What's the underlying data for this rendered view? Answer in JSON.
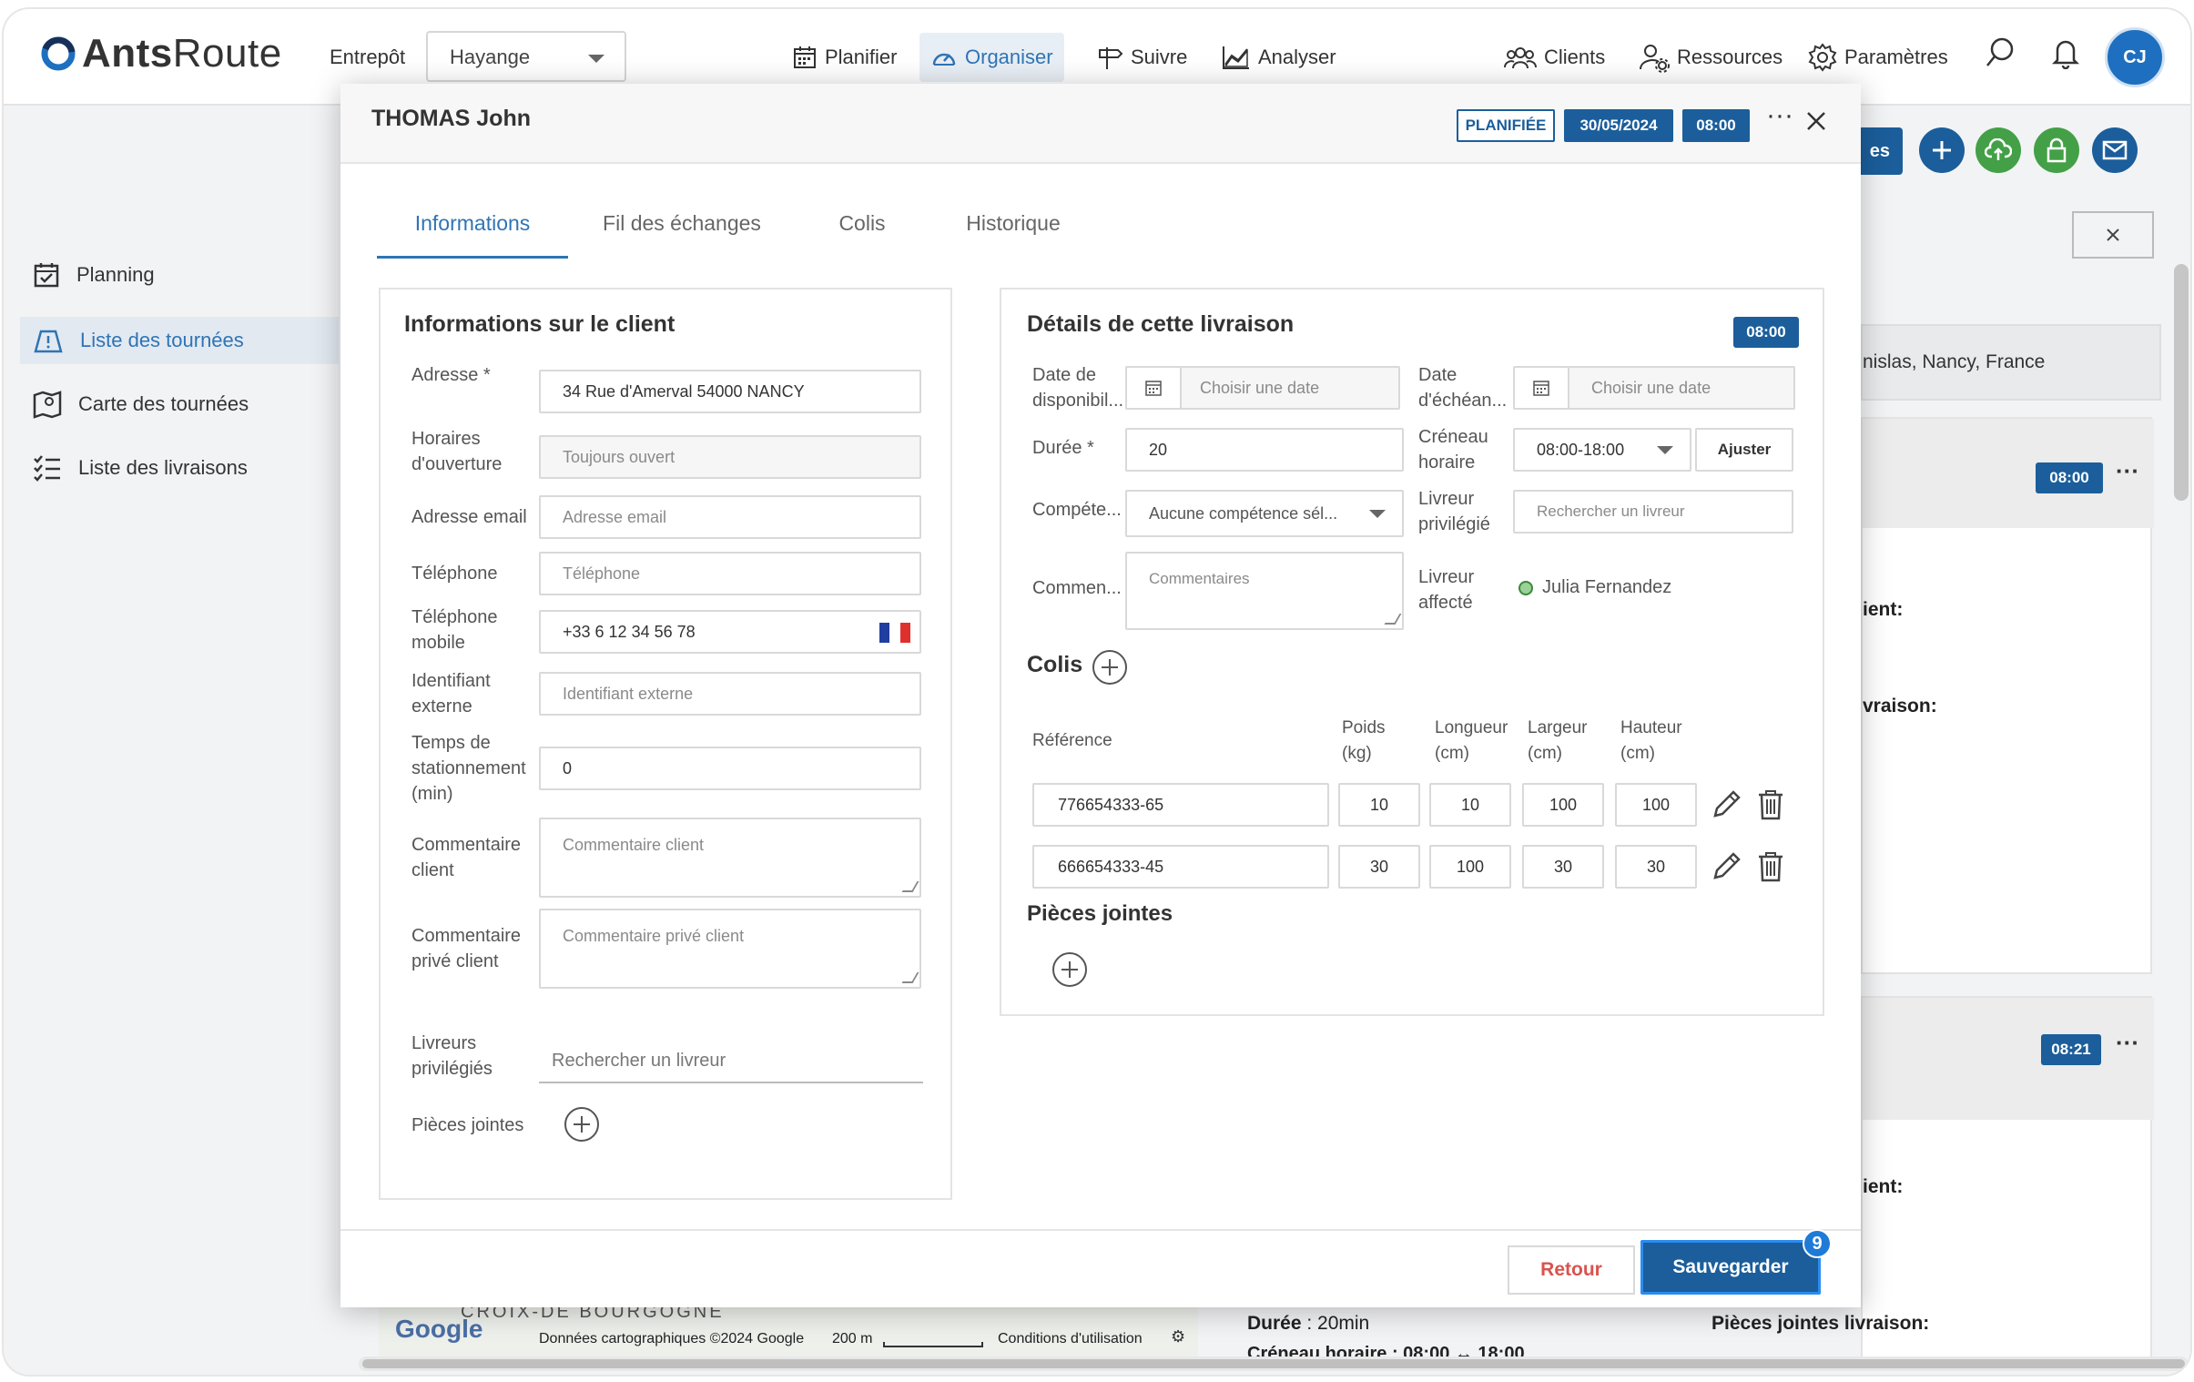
{
  "header": {
    "brand": {
      "word1": "Ants",
      "word2": "Route"
    },
    "entrepot_label": "Entrepôt",
    "entrepot_value": "Hayange",
    "nav": [
      {
        "label": "Planifier",
        "icon": "calendar-icon"
      },
      {
        "label": "Organiser",
        "icon": "gauge-icon"
      },
      {
        "label": "Suivre",
        "icon": "signpost-icon"
      },
      {
        "label": "Analyser",
        "icon": "chart-icon"
      },
      {
        "label": "Clients",
        "icon": "users-icon"
      },
      {
        "label": "Ressources",
        "icon": "resources-icon"
      },
      {
        "label": "Paramètres",
        "icon": "gear-icon"
      }
    ],
    "avatar_initials": "CJ"
  },
  "sidebar": {
    "items": [
      {
        "label": "Planning",
        "icon": "calendar-check-icon"
      },
      {
        "label": "Liste des tournées",
        "icon": "map-route-icon"
      },
      {
        "label": "Carte des tournées",
        "icon": "map-pin-icon"
      },
      {
        "label": "Liste des livraisons",
        "icon": "list-icon"
      }
    ]
  },
  "background": {
    "button_partial": "es",
    "address_partial": "nislas, Nancy, France",
    "card1_time": "08:00",
    "card1_line1": "ient:",
    "card1_line2": "vraison:",
    "card2_time": "08:21",
    "card2_line1": "ient:",
    "duree_label": "Durée",
    "duree_value": " : 20min",
    "creneau_partial": "Créneau horaire : 08:00 ↔ 18:00",
    "pieces_label": "Pièces jointes livraison:",
    "map_attribution": "Données cartographiques ©2024 Google",
    "map_scale": "200 m",
    "map_terms": "Conditions d'utilisation",
    "map_place": "CROIX-DE BOURGOGNE",
    "google": "Google"
  },
  "modal": {
    "title": "THOMAS John",
    "status": "PLANIFIÉE",
    "date": "30/05/2024",
    "time": "08:00",
    "tabs": [
      "Informations",
      "Fil des échanges",
      "Colis",
      "Historique"
    ],
    "client": {
      "title": "Informations sur le client",
      "adresse_label": "Adresse *",
      "adresse_value": "34 Rue d'Amerval 54000 NANCY",
      "horaires_label": "Horaires d'ouverture",
      "horaires_value": "Toujours ouvert",
      "email_label": "Adresse email",
      "email_placeholder": "Adresse email",
      "tel_label": "Téléphone",
      "tel_placeholder": "Téléphone",
      "mobile_label": "Téléphone mobile",
      "mobile_value": "+33 6 12 34 56 78",
      "ext_label": "Identifiant externe",
      "ext_placeholder": "Identifiant externe",
      "stat_label": "Temps de stationnement (min)",
      "stat_value": "0",
      "comment_label": "Commentaire client",
      "comment_placeholder": "Commentaire client",
      "private_label": "Commentaire privé client",
      "private_placeholder": "Commentaire privé client",
      "livreurs_label": "Livreurs privilégiés",
      "livreurs_placeholder": "Rechercher un livreur",
      "pieces_label": "Pièces jointes"
    },
    "delivery": {
      "title": "Détails de cette livraison",
      "time": "08:00",
      "dispo_label": "Date de disponibil...",
      "dispo_placeholder": "Choisir une date",
      "echeance_label": "Date d'échéan...",
      "echeance_placeholder": "Choisir une date",
      "duree_label": "Durée *",
      "duree_value": "20",
      "creneau_label": "Créneau horaire",
      "creneau_value": "08:00-18:00",
      "ajuster_label": "Ajuster",
      "competence_label": "Compéte...",
      "competence_value": "Aucune compétence sél...",
      "livreur_priv_label": "Livreur privilégié",
      "livreur_priv_placeholder": "Rechercher un livreur",
      "comment_label": "Commen...",
      "comment_placeholder": "Commentaires",
      "livreur_aff_label": "Livreur affecté",
      "livreur_aff_value": "Julia Fernandez",
      "colis_title": "Colis",
      "colis_headers": {
        "reference": "Référence",
        "poids": "Poids (kg)",
        "longueur": "Longueur (cm)",
        "largeur": "Largeur (cm)",
        "hauteur": "Hauteur (cm)"
      },
      "colis_rows": [
        {
          "ref": "776654333-65",
          "poids": "10",
          "longueur": "10",
          "largeur": "100",
          "hauteur": "100"
        },
        {
          "ref": "666654333-45",
          "poids": "30",
          "longueur": "100",
          "largeur": "30",
          "hauteur": "30"
        }
      ],
      "pieces_title": "Pièces jointes"
    },
    "footer": {
      "retour": "Retour",
      "save": "Sauvegarder",
      "save_count": "9"
    }
  },
  "colors": {
    "primary": "#1b5e9b",
    "accent_link": "#2f74b5",
    "danger": "#d9534f",
    "success": "#43a047"
  }
}
